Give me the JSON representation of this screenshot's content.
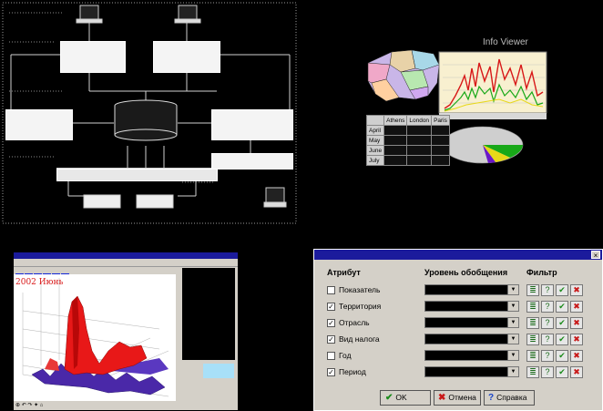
{
  "diagram": {
    "top_title": "",
    "left_label": "",
    "mid_label": "",
    "bottom_label": ""
  },
  "collage": {
    "chart_title": "Info Viewer",
    "table": {
      "columns": [
        "",
        "Athens",
        "London",
        "Paris"
      ],
      "rows": [
        {
          "label": "April",
          "values": [
            "",
            "",
            ""
          ]
        },
        {
          "label": "May",
          "values": [
            "",
            "",
            ""
          ]
        },
        {
          "label": "June",
          "values": [
            "",
            "",
            ""
          ]
        },
        {
          "label": "July",
          "values": [
            "",
            "",
            ""
          ]
        }
      ]
    }
  },
  "map_window": {
    "title": "",
    "year_label": "2002 Июнь",
    "legend_items": [
      "",
      "",
      ""
    ]
  },
  "dialog": {
    "title": "",
    "close_glyph": "×",
    "col_attr": "Атрибут",
    "col_level": "Уровень обобщения",
    "col_filter": "Фильтр",
    "rows": [
      {
        "label": "Показатель",
        "checked": false,
        "level": ""
      },
      {
        "label": "Территория",
        "checked": true,
        "level": ""
      },
      {
        "label": "Отрасль",
        "checked": true,
        "level": ""
      },
      {
        "label": "Вид налога",
        "checked": true,
        "level": ""
      },
      {
        "label": "Год",
        "checked": false,
        "level": ""
      },
      {
        "label": "Период",
        "checked": true,
        "level": ""
      }
    ],
    "buttons": {
      "ok": "OK",
      "cancel": "Отмена",
      "help": "Справка"
    },
    "colors": {
      "ok": "#1a8a1a",
      "cancel": "#c81818",
      "help": "#1844c8"
    }
  }
}
